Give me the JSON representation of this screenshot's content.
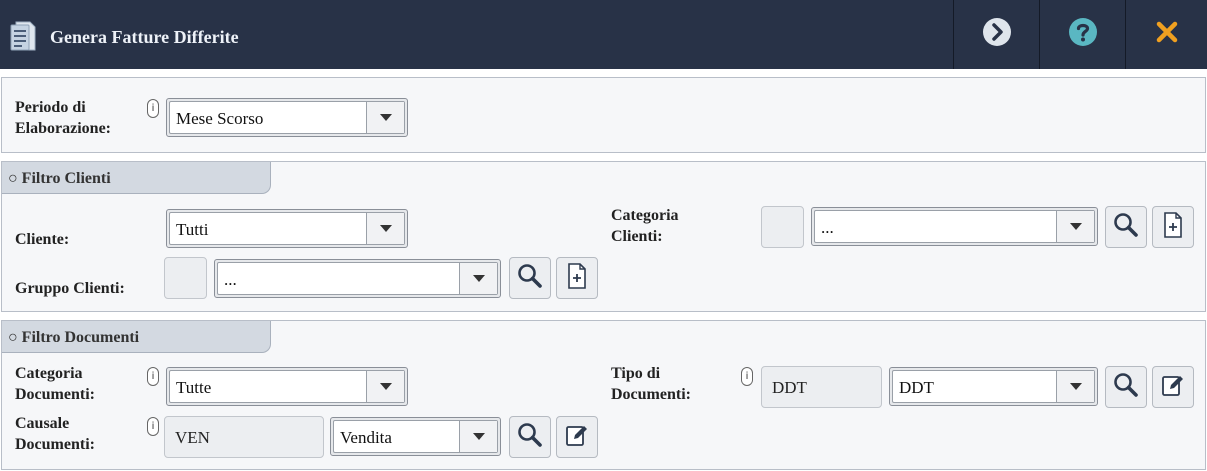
{
  "window": {
    "title": "Genera Fatture Differite"
  },
  "periodo": {
    "label": "Periodo di Elaborazione:",
    "info": "i",
    "value": "Mese Scorso"
  },
  "filtro_clienti": {
    "header": "○ Filtro Clienti",
    "cliente_label": "Cliente:",
    "cliente_value": "Tutti",
    "gruppo_label": "Gruppo Clienti:",
    "gruppo_code": "",
    "gruppo_value": "...",
    "categoria_label": "Categoria Clienti:",
    "categoria_code": "",
    "categoria_value": "..."
  },
  "filtro_documenti": {
    "header": "○ Filtro Documenti",
    "categoria_label": "Categoria Documenti:",
    "categoria_info": "i",
    "categoria_value": "Tutte",
    "causale_label": "Causale Documenti:",
    "causale_info": "i",
    "causale_code": "VEN",
    "causale_value": "Vendita",
    "tipo_label": "Tipo di Documenti:",
    "tipo_info": "i",
    "tipo_code": "DDT",
    "tipo_value": "DDT"
  },
  "colors": {
    "titlebar_bg": "#283247",
    "accent_teal": "#5ab7c2",
    "accent_orange": "#f0a020"
  }
}
